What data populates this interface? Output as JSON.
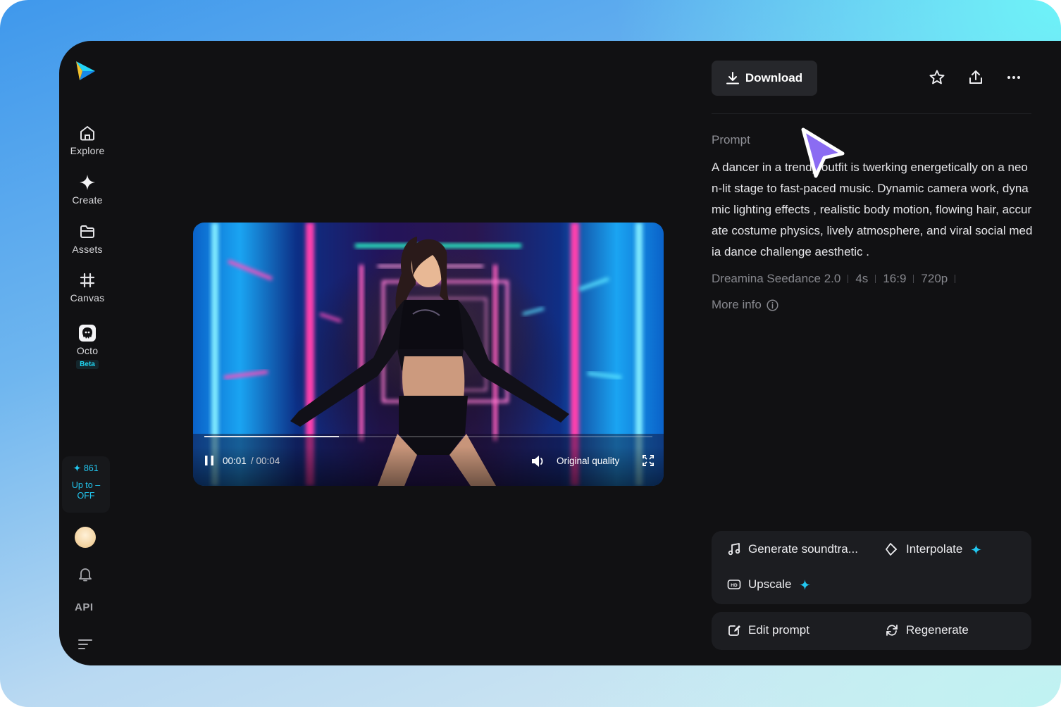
{
  "sidebar": {
    "items": [
      {
        "label": "Explore",
        "icon": "home-icon"
      },
      {
        "label": "Create",
        "icon": "sparkle-icon"
      },
      {
        "label": "Assets",
        "icon": "folder-icon"
      },
      {
        "label": "Canvas",
        "icon": "canvas-icon"
      },
      {
        "label": "Octo",
        "icon": "octo-icon",
        "badge": "Beta"
      }
    ],
    "credits": {
      "count": "861",
      "upto": "Up to –",
      "off": "OFF"
    },
    "api_label": "API"
  },
  "video": {
    "current_time": "00:01",
    "total_time": "/ 00:04",
    "progress": 0.3,
    "quality_label": "Original quality"
  },
  "toolbar": {
    "download_label": "Download"
  },
  "details": {
    "prompt_label": "Prompt",
    "prompt_text": "A dancer in a trendy outfit is twerking energetically on a neon-lit stage to fast-paced music. Dynamic camera work, dynamic lighting effects , realistic body motion, flowing hair, accurate costume physics, lively atmosphere, and viral social media dance challenge aesthetic .",
    "meta": [
      "Dreamina Seedance 2.0",
      "4s",
      "16:9",
      "720p"
    ],
    "more_info_label": "More info"
  },
  "actions": {
    "generate_soundtrack": "Generate soundtra...",
    "interpolate": "Interpolate",
    "upscale": "Upscale",
    "edit_prompt": "Edit prompt",
    "regenerate": "Regenerate"
  },
  "colors": {
    "accent": "#22c7f0",
    "cursor": "#8b6cf2",
    "panel_bg": "#111113"
  }
}
